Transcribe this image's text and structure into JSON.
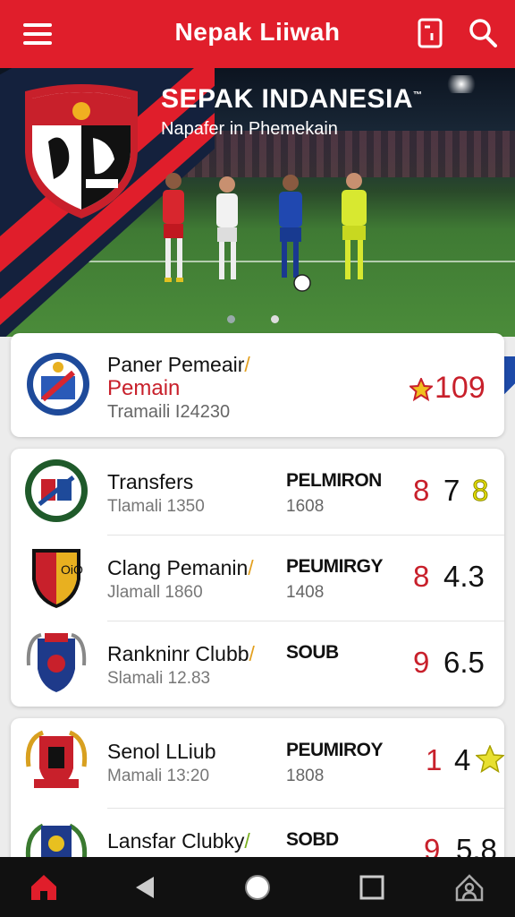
{
  "app": {
    "title": "Nepak Liiwah"
  },
  "icons": {
    "menu": "hamburger-menu-icon",
    "bookmark": "document-icon",
    "search": "search-icon"
  },
  "colors": {
    "brand": "#e01e2b",
    "accent_red": "#c8202b",
    "star": "#f0c020"
  },
  "hero": {
    "title": "SEPAK INDANESIA",
    "title_mark": "™",
    "subtitle": "Napafer in Phemekain",
    "carousel_pages": 2,
    "carousel_active": 1
  },
  "featured": {
    "title": "Paner Pemeair",
    "slash": "/",
    "subtitle": "Pemain",
    "meta": "Tramaili I24230",
    "score": "109"
  },
  "rows": [
    {
      "name": "Transfers",
      "slash": "",
      "meta": "Tlamali 1350",
      "code": "PELMIRON",
      "num": "1608",
      "a": "8",
      "b": "7",
      "c": "8",
      "c_type": "yellow"
    },
    {
      "name": "Clang Pemanin",
      "slash": "/",
      "meta": "Jlamall 1860",
      "code": "PEUMIRGY",
      "num": "1408",
      "a": "8",
      "b": "4.3",
      "c": "",
      "c_type": "none"
    },
    {
      "name": "Rankninr Clubb",
      "slash": "/",
      "meta": "Slamali 12.83",
      "code": "SOUB",
      "num": "",
      "a": "9",
      "b": "6.5",
      "c": "",
      "c_type": "none"
    },
    {
      "name": "Senol LLiub",
      "slash": "",
      "meta": "Mamali 13:20",
      "code": "PEUMIROY",
      "num": "1808",
      "a": "1",
      "b": "4",
      "c": "",
      "c_type": "star"
    },
    {
      "name": "Lansfar Clubky",
      "slash": "/",
      "meta": "",
      "code": "SOBD",
      "num": "",
      "a": "9",
      "b": "5.8",
      "c": "",
      "c_type": "none"
    }
  ],
  "navbar": [
    "home-icon",
    "back-icon",
    "circle-home-icon",
    "recents-icon",
    "profile-icon"
  ]
}
